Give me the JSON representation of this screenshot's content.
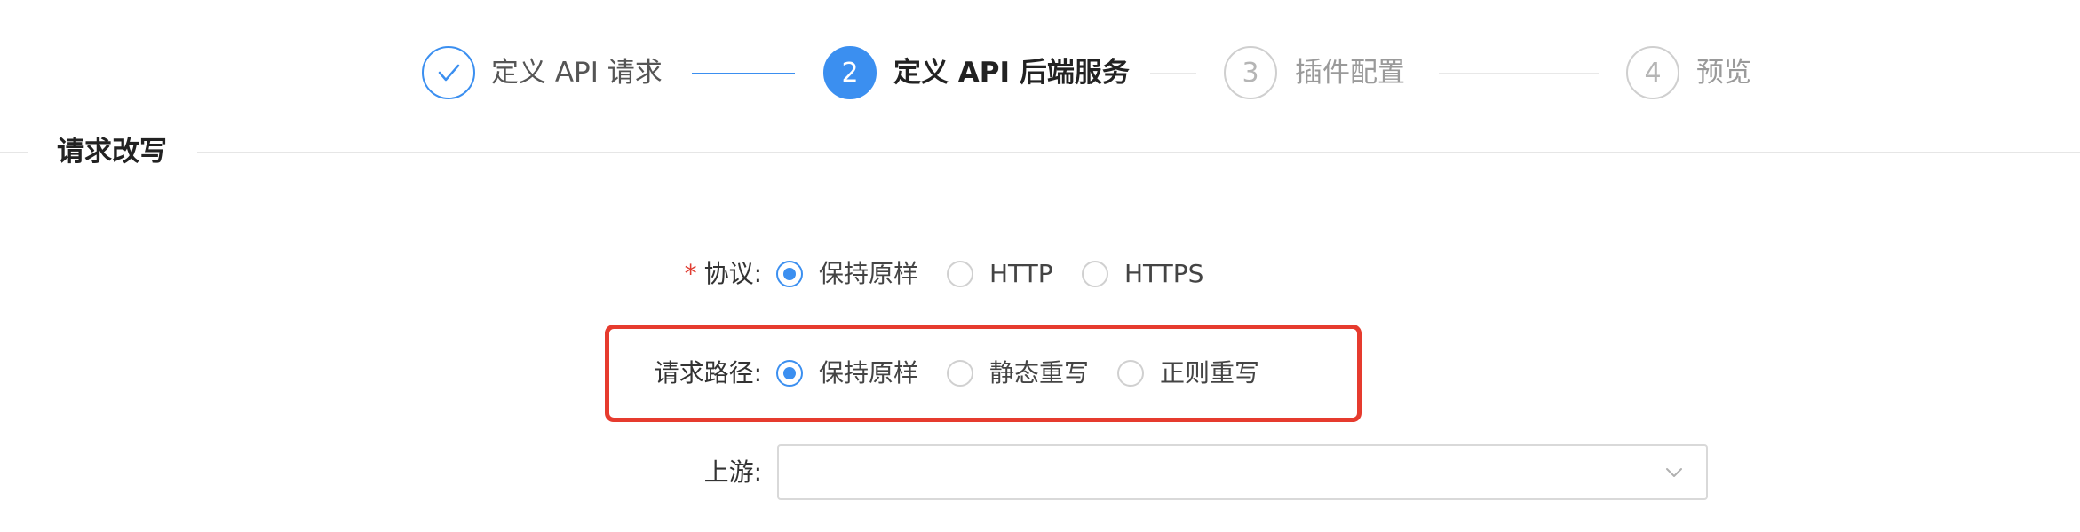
{
  "steps": [
    {
      "number": "",
      "title": "定义 API 请求",
      "status": "done"
    },
    {
      "number": "2",
      "title": "定义 API 后端服务",
      "status": "active"
    },
    {
      "number": "3",
      "title": "插件配置",
      "status": "wait"
    },
    {
      "number": "4",
      "title": "预览",
      "status": "wait"
    }
  ],
  "section": {
    "title": "请求改写"
  },
  "form": {
    "protocol": {
      "required_mark": "*",
      "label": "协议:",
      "options": [
        "保持原样",
        "HTTP",
        "HTTPS"
      ],
      "selected": "保持原样"
    },
    "request_path": {
      "label": "请求路径:",
      "options": [
        "保持原样",
        "静态重写",
        "正则重写"
      ],
      "selected": "保持原样"
    },
    "upstream": {
      "label": "上游:",
      "value": ""
    }
  },
  "colors": {
    "primary": "#3b8ff0",
    "highlight": "#e63b2e",
    "required": "#e03c31"
  }
}
